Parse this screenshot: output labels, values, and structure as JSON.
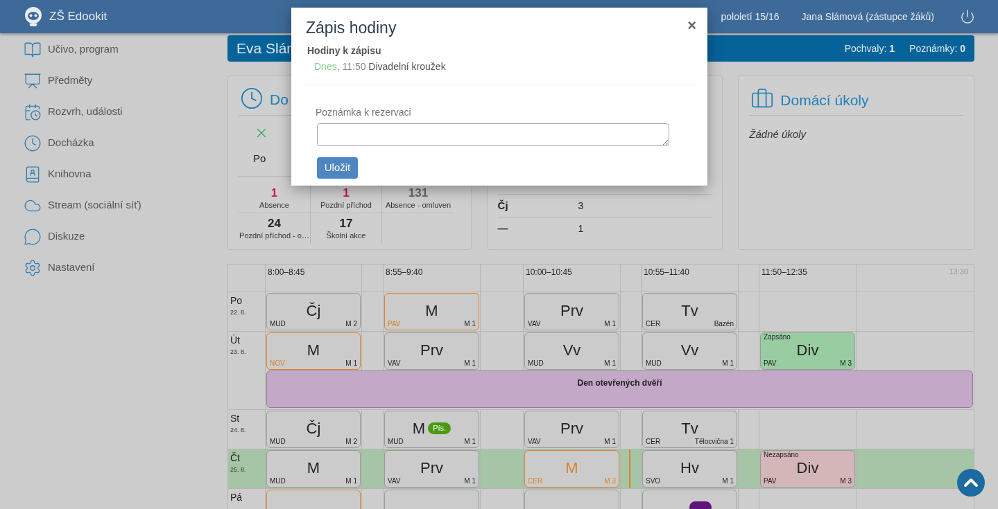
{
  "header": {
    "school": "ZŠ Edookit",
    "term": "pololetí 15/16",
    "user": "Jana Slámová (zástupce žáků)"
  },
  "sidebar": {
    "items": [
      {
        "label": "Učivo, program"
      },
      {
        "label": "Předměty"
      },
      {
        "label": "Rozvrh, události"
      },
      {
        "label": "Docházka"
      },
      {
        "label": "Knihovna"
      },
      {
        "label": "Stream (sociální síť)"
      },
      {
        "label": "Diskuze"
      },
      {
        "label": "Nastavení"
      }
    ]
  },
  "student_bar": {
    "name": "Eva Slán",
    "praise_label": "Pochvaly:",
    "praise": "1",
    "notes_label": "Poznámky:",
    "notes": "0"
  },
  "attendance": {
    "title": "Do",
    "day": "Po",
    "stats": [
      {
        "value": "1",
        "label": "Absence",
        "color": "#c4195a"
      },
      {
        "value": "1",
        "label": "Pozdní příchod",
        "color": "#c4195a"
      },
      {
        "value": "131",
        "label": "Absence - omluven",
        "color": "#666666"
      },
      {
        "value": "24",
        "label": "Pozdní příchod - o…",
        "color": "#222222"
      },
      {
        "value": "17",
        "label": "Školní akce",
        "color": "#222222"
      }
    ]
  },
  "grades": {
    "rows": [
      {
        "subject": "Čj",
        "value": "3"
      },
      {
        "subject": "—",
        "value": "1"
      }
    ]
  },
  "homework": {
    "title": "Domácí úkoly",
    "empty_text": "Žádné úkoly"
  },
  "timetable": {
    "times": [
      "8:00–8:45",
      "8:55–9:40",
      "10:00–10:45",
      "10:55–11:40",
      "11:50–12:35"
    ],
    "end_time": "13:30",
    "days": [
      {
        "name": "Po",
        "date": "22. 8.",
        "current": false,
        "lessons": [
          {
            "kind": "lesson",
            "subject": "Čj",
            "teacher": "MUD",
            "room": "M 2",
            "changed": false,
            "current": false
          },
          {
            "kind": "lesson",
            "subject": "M",
            "teacher": "PAV",
            "room": "M 1",
            "changed": true,
            "current": false
          },
          {
            "kind": "lesson",
            "subject": "Prv",
            "teacher": "VAV",
            "room": "M 1",
            "changed": false,
            "current": false
          },
          {
            "kind": "lesson",
            "subject": "Tv",
            "teacher": "CER",
            "room": "Bazén",
            "changed": false,
            "current": false
          },
          {
            "kind": "empty"
          }
        ]
      },
      {
        "name": "Út",
        "date": "23. 8.",
        "current": false,
        "lessons": [
          {
            "kind": "lesson",
            "subject": "M",
            "teacher": "NOV",
            "room": "M 1",
            "changed": true,
            "current": false
          },
          {
            "kind": "lesson",
            "subject": "Prv",
            "teacher": "VAV",
            "room": "M 1",
            "changed": false,
            "current": false
          },
          {
            "kind": "lesson",
            "subject": "Vv",
            "teacher": "MUD",
            "room": "M 1",
            "changed": false,
            "current": false
          },
          {
            "kind": "lesson",
            "subject": "Vv",
            "teacher": "MUD",
            "room": "M 1",
            "changed": false,
            "current": false
          },
          {
            "kind": "lesson",
            "subject": "Div",
            "teacher": "PAV",
            "room": "M 3",
            "changed": false,
            "current": false,
            "tag": "Zapsáno",
            "color": "#98cda2"
          }
        ],
        "events": [
          {
            "title": "Den otevřených dvěří",
            "color": "#c4a8c8"
          }
        ]
      },
      {
        "name": "St",
        "date": "24. 8.",
        "current": false,
        "lessons": [
          {
            "kind": "lesson",
            "subject": "Čj",
            "teacher": "MUD",
            "room": "M 2",
            "changed": false,
            "current": false
          },
          {
            "kind": "lesson",
            "subject": "M",
            "teacher": "MUD",
            "room": "M 1",
            "changed": false,
            "current": false,
            "badge": {
              "text": "Pís.",
              "color": "#4b9a12"
            }
          },
          {
            "kind": "lesson",
            "subject": "Prv",
            "teacher": "VAV",
            "room": "M 1",
            "changed": false,
            "current": false
          },
          {
            "kind": "lesson",
            "subject": "Tv",
            "teacher": "CER",
            "room": "Tělocvična 1",
            "changed": false,
            "current": false
          },
          {
            "kind": "empty"
          }
        ]
      },
      {
        "name": "Čt",
        "date": "25. 8.",
        "current": true,
        "lessons": [
          {
            "kind": "lesson",
            "subject": "M",
            "teacher": "MUD",
            "room": "M 1",
            "changed": false,
            "current": false
          },
          {
            "kind": "lesson",
            "subject": "Prv",
            "teacher": "VAV",
            "room": "M 1",
            "changed": false,
            "current": false
          },
          {
            "kind": "lesson",
            "subject": "M",
            "teacher": "CER",
            "room": "M 3",
            "changed": true,
            "current": true
          },
          {
            "kind": "lesson",
            "subject": "Hv",
            "teacher": "SVO",
            "room": "M 1",
            "changed": false,
            "current": false
          },
          {
            "kind": "lesson",
            "subject": "Div",
            "teacher": "PAV",
            "room": "M 3",
            "changed": false,
            "current": false,
            "tag": "Nezapsáno",
            "color": "#d4b6b8"
          }
        ]
      },
      {
        "name": "Pá",
        "current": false,
        "lessons": [
          {
            "kind": "lesson",
            "changed": true
          },
          {
            "kind": "lesson",
            "changed": false
          },
          {
            "kind": "lesson",
            "changed": false
          },
          {
            "kind": "lesson",
            "changed": false,
            "badge": {
              "color": "#5e1478"
            }
          },
          {
            "kind": "empty"
          }
        ]
      }
    ]
  },
  "dialog": {
    "title": "Zápis hodiny",
    "close": "×",
    "section_title": "Hodiny k zápisu",
    "entry": {
      "day": "Dnes",
      "time": ", 11:50",
      "name": "Divadelní kroužek"
    },
    "note_label": "Poznámka k rezervaci",
    "save": "Uložit"
  }
}
